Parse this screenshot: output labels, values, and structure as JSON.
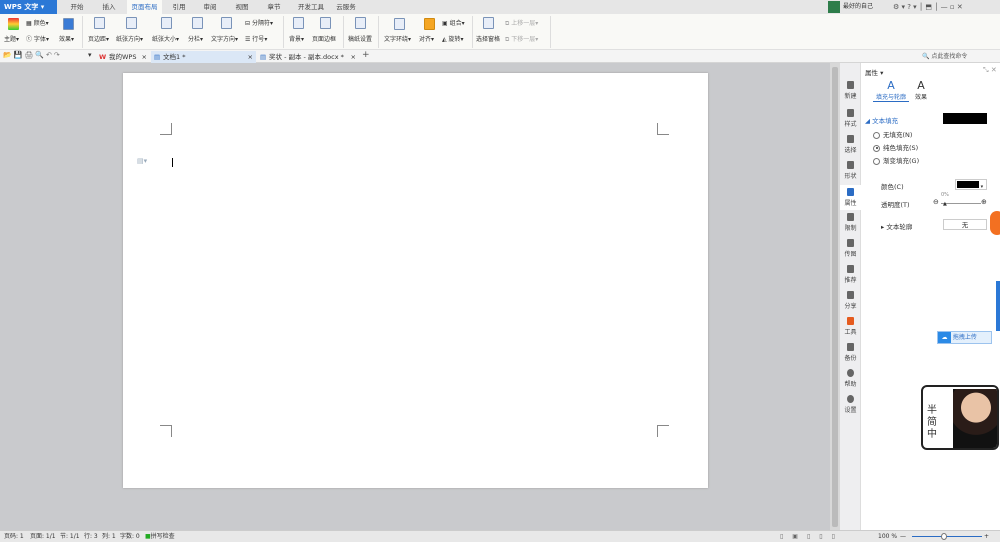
{
  "app": {
    "menu_label": "WPS 文字"
  },
  "tabs": [
    "开始",
    "插入",
    "页面布局",
    "引用",
    "审阅",
    "视图",
    "章节",
    "开发工具",
    "云服务"
  ],
  "active_tab": "页面布局",
  "user": {
    "name": "最好的自己"
  },
  "ribbon": {
    "theme": "主题",
    "color": "颜色",
    "font": "字体",
    "effect": "效果",
    "margins": "页边距",
    "orientation": "纸张方向",
    "size": "纸张大小",
    "columns": "分栏",
    "text_direction": "文字方向",
    "breaks": "分隔符",
    "line_numbers": "行号",
    "background": "背景",
    "page_border": "页面边框",
    "manuscript": "稿纸设置",
    "wrap_text": "文字环绕",
    "align": "对齐",
    "group": "组合",
    "rotate": "旋转",
    "selection_pane": "选择窗格",
    "bring_forward": "上移一层",
    "send_backward": "下移一层",
    "search_cmd": "点此查找命令"
  },
  "doc_tabs": [
    {
      "label": "我的WPS"
    },
    {
      "label": "文档1 *"
    },
    {
      "label": "奖状 - 副本 - 副本.docx *"
    }
  ],
  "sidebar": [
    "新建",
    "样式",
    "选择",
    "形状",
    "属性",
    "限制",
    "传图",
    "推荐",
    "分享",
    "工具",
    "备份",
    "帮助",
    "设置"
  ],
  "panel": {
    "title": "属性",
    "tab_fill": "填充与轮廓",
    "tab_effect": "效果",
    "text_fill": "文本填充",
    "no_fill": "无填充(N)",
    "solid_fill": "纯色填充(S)",
    "gradient_fill": "渐变填充(G)",
    "color_label": "颜色(C)",
    "transparency_label": "透明度(T)",
    "transparency_value": "0%",
    "text_outline": "文本轮廓",
    "outline_value": "无",
    "upload": "拖拽上传",
    "fill_color": "#000000"
  },
  "status": {
    "page_num": "页码: 1",
    "pages": "页面: 1/1",
    "section": "节: 1/1",
    "row": "行: 3",
    "col": "列: 1",
    "words": "字数: 0",
    "spell": "拼写检查",
    "zoom": "100 %"
  },
  "sticker": {
    "text": "半 简 中"
  }
}
